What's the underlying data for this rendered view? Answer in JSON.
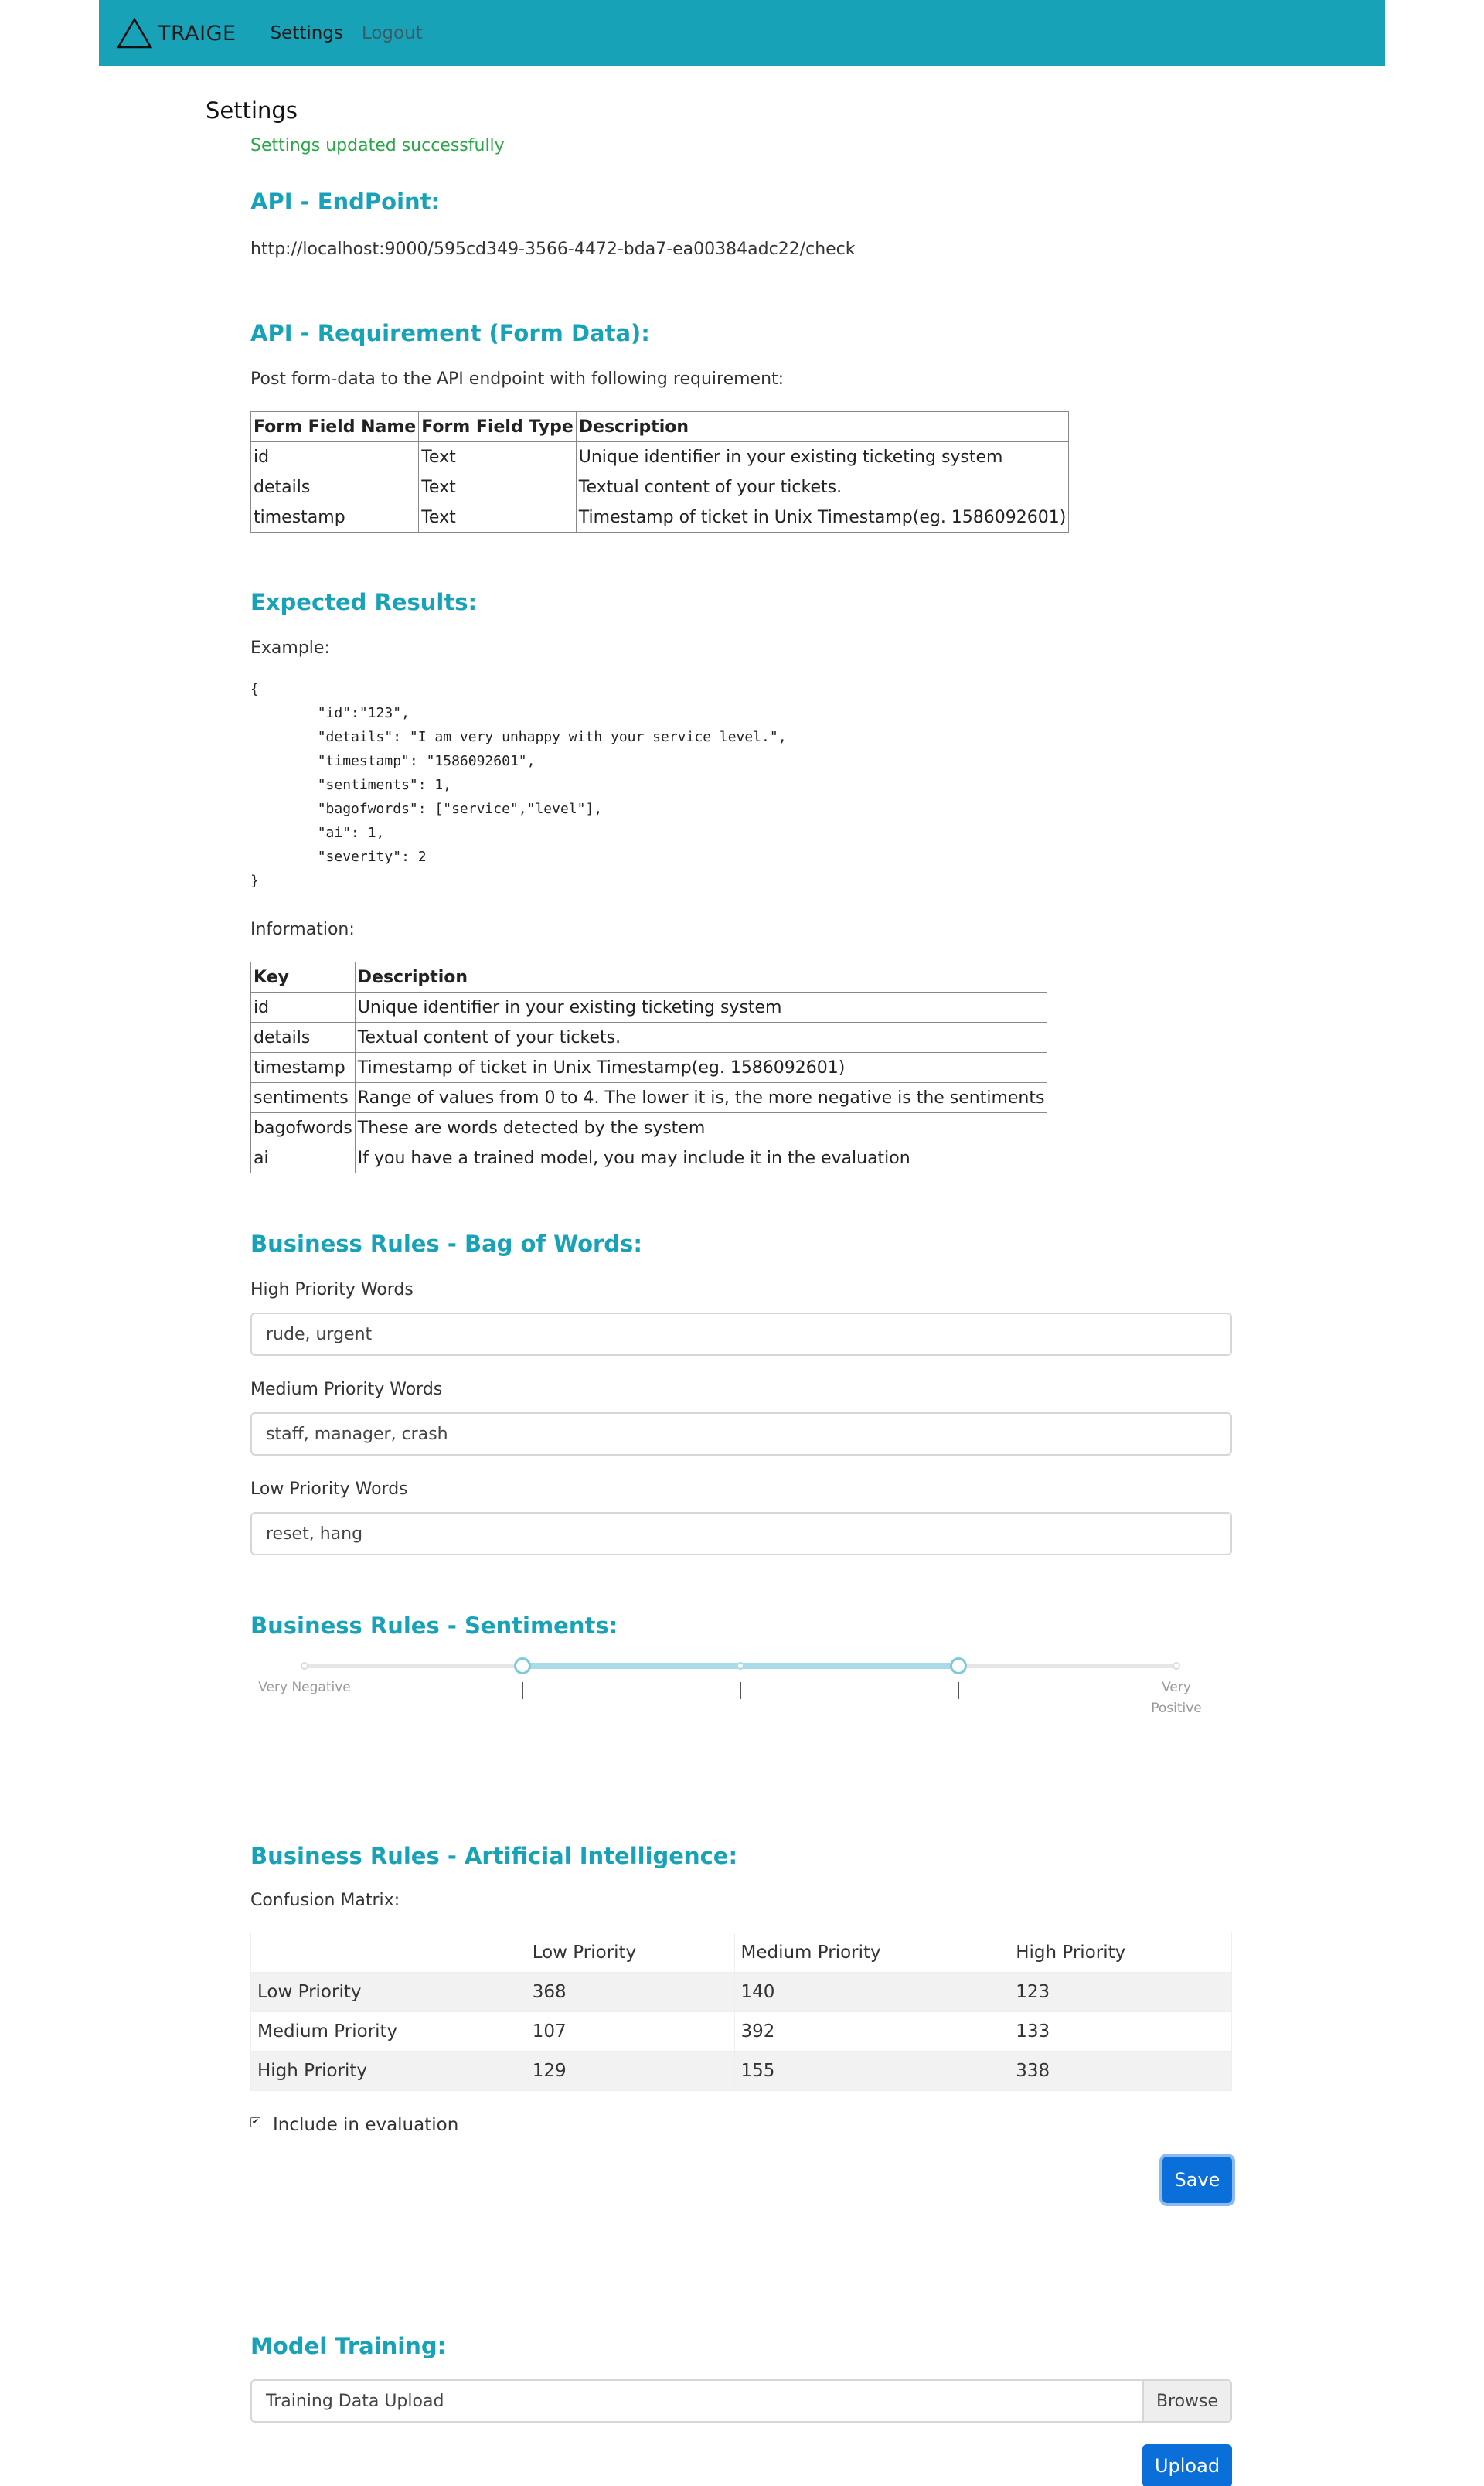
{
  "nav": {
    "brand": "TRAIGE",
    "settings": "Settings",
    "logout": "Logout"
  },
  "page_title": "Settings",
  "alert": "Settings updated successfully",
  "endpoint": {
    "title": "API - EndPoint:",
    "url": "http://localhost:9000/595cd349-3566-4472-bda7-ea00384adc22/check"
  },
  "requirement": {
    "title": "API - Requirement (Form Data):",
    "intro": "Post form-data to the API endpoint with following requirement:",
    "headers": [
      "Form Field Name",
      "Form Field Type",
      "Description"
    ],
    "rows": [
      [
        "id",
        "Text",
        "Unique identifier in your existing ticketing system"
      ],
      [
        "details",
        "Text",
        "Textual content of your tickets."
      ],
      [
        "timestamp",
        "Text",
        "Timestamp of ticket in Unix Timestamp(eg. 1586092601)"
      ]
    ]
  },
  "expected": {
    "title": "Expected Results:",
    "example_label": "Example:",
    "example_code": "{\n        \"id\":\"123\",\n        \"details\": \"I am very unhappy with your service level.\",\n        \"timestamp\": \"1586092601\",\n        \"sentiments\": 1,\n        \"bagofwords\": [\"service\",\"level\"],\n        \"ai\": 1,\n        \"severity\": 2\n}",
    "info_label": "Information:",
    "headers": [
      "Key",
      "Description"
    ],
    "rows": [
      [
        "id",
        "Unique identifier in your existing ticketing system"
      ],
      [
        "details",
        "Textual content of your tickets."
      ],
      [
        "timestamp",
        "Timestamp of ticket in Unix Timestamp(eg. 1586092601)"
      ],
      [
        "sentiments",
        "Range of values from 0 to 4. The lower it is, the more negative is the sentiments"
      ],
      [
        "bagofwords",
        "These are words detected by the system"
      ],
      [
        "ai",
        "If you have a trained model, you may include it in the evaluation"
      ]
    ]
  },
  "bag_of_words": {
    "title": "Business Rules - Bag of Words:",
    "high_label": "High Priority Words",
    "high_value": "rude, urgent",
    "medium_label": "Medium Priority Words",
    "medium_value": "staff, manager, crash",
    "low_label": "Low Priority Words",
    "low_value": "reset, hang"
  },
  "sentiments": {
    "title": "Business Rules - Sentiments:",
    "scale_min": 0,
    "scale_max": 4,
    "range_low": 1,
    "range_high": 3,
    "label_min": "Very Negative",
    "label_max_line1": "Very",
    "label_max_line2": "Positive",
    "tick_marks": [
      "|",
      "|",
      "|"
    ]
  },
  "ai": {
    "title": "Business Rules - Artificial Intelligence:",
    "matrix_label": "Confusion Matrix:",
    "headers": [
      "",
      "Low Priority",
      "Medium Priority",
      "High Priority"
    ],
    "rows": [
      [
        "Low Priority",
        "368",
        "140",
        "123"
      ],
      [
        "Medium Priority",
        "107",
        "392",
        "133"
      ],
      [
        "High Priority",
        "129",
        "155",
        "338"
      ]
    ],
    "include_label": "Include in evaluation",
    "include_checked": true,
    "save_label": "Save"
  },
  "training": {
    "title": "Model Training:",
    "file_placeholder": "Training Data Upload",
    "browse_label": "Browse",
    "upload_label": "Upload"
  },
  "colors": {
    "navbar": "#17a2b8",
    "accent": "#17a2b8",
    "success": "#28a745",
    "primary_button": "#0a6fd8"
  }
}
